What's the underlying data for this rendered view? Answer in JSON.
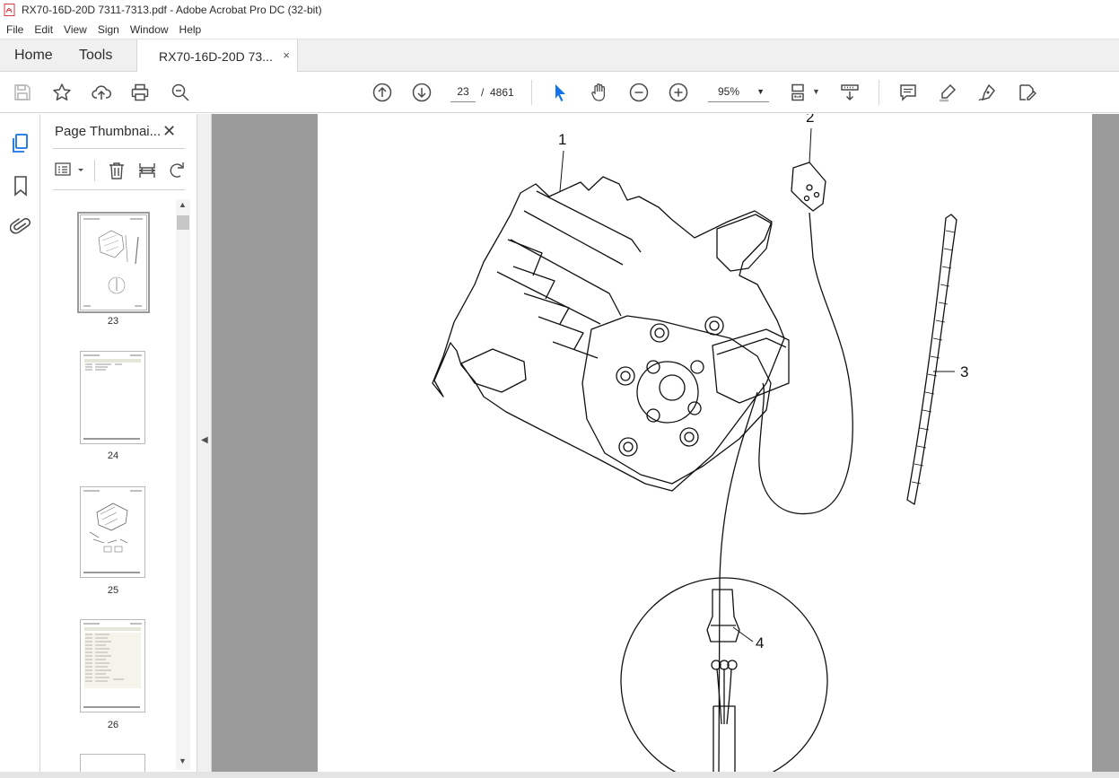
{
  "window": {
    "title": "RX70-16D-20D  7311-7313.pdf - Adobe Acrobat Pro DC (32-bit)"
  },
  "menu": [
    "File",
    "Edit",
    "View",
    "Sign",
    "Window",
    "Help"
  ],
  "tabs": {
    "home": "Home",
    "tools": "Tools",
    "document": "RX70-16D-20D  73...",
    "close": "×"
  },
  "toolbar": {
    "page_current": "23",
    "page_separator": "/",
    "page_total": "4861",
    "zoom": "95%"
  },
  "panel": {
    "title": "Page Thumbnai...",
    "close": "✕"
  },
  "thumbnails": [
    {
      "label": "23",
      "selected": true
    },
    {
      "label": "24",
      "selected": false
    },
    {
      "label": "25",
      "selected": false
    },
    {
      "label": "26",
      "selected": false
    }
  ],
  "callouts": {
    "c1": "1",
    "c2": "2",
    "c3": "3",
    "c4": "4"
  },
  "colors": {
    "accent_blue": "#1473e6",
    "doc_background": "#9b9b9b",
    "acrobat_red": "#d7373f"
  }
}
